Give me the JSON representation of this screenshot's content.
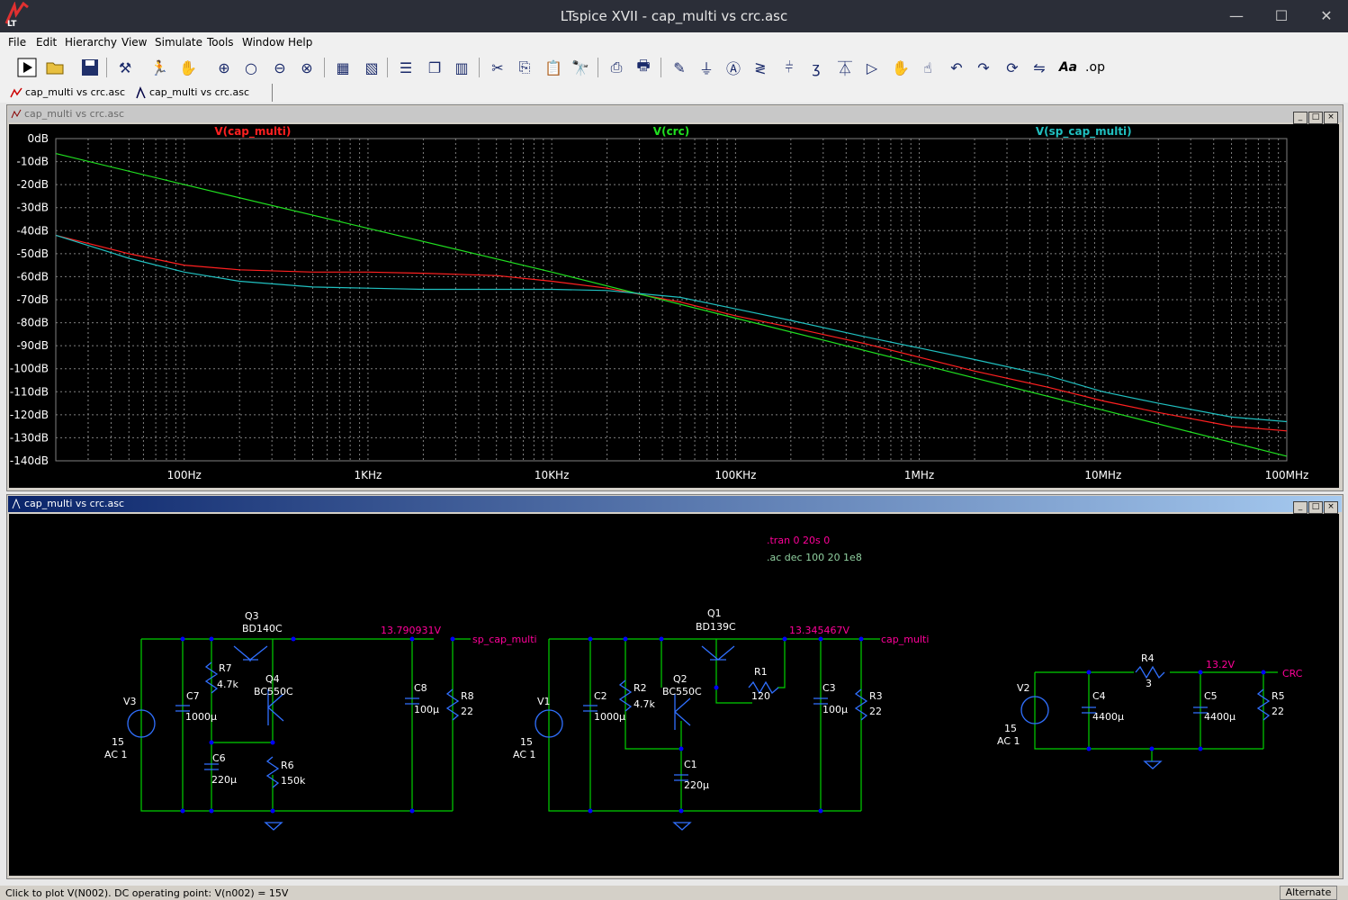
{
  "app": {
    "title": "LTspice XVII - cap_multi vs crc.asc",
    "window_buttons": {
      "minimize": "—",
      "maximize": "☐",
      "close": "✕"
    }
  },
  "menu": [
    "File",
    "Edit",
    "Hierarchy",
    "View",
    "Simulate",
    "Tools",
    "Window",
    "Help"
  ],
  "toolbar": {
    "icons": [
      "run-icon",
      "open-icon",
      "save-icon",
      "control-panel-icon",
      "halt-icon",
      "pan-icon",
      "zoom-in-icon",
      "zoom-full-icon",
      "zoom-out-icon",
      "zoom-cancel-icon",
      "autorange-icon",
      "fit-icon",
      "tile-horizontal-icon",
      "cascade-icon",
      "tile-vertical-icon",
      "cut-icon",
      "copy-icon",
      "paste-icon",
      "find-icon",
      "print-setup-icon",
      "print-icon",
      "wire-icon",
      "ground-icon",
      "label-net-icon",
      "resistor-icon",
      "capacitor-icon",
      "inductor-icon",
      "diode-icon",
      "component-icon",
      "move-icon",
      "drag-icon",
      "undo-icon",
      "redo-icon",
      "rotate-icon",
      "mirror-icon",
      "text-icon",
      "spice-directive-icon"
    ],
    "text_glyphs": {
      "text": "Aa",
      "spice": ".op"
    }
  },
  "tabs": [
    {
      "label": "cap_multi vs crc.asc",
      "icon": "waveform-icon"
    },
    {
      "label": "cap_multi vs crc.asc",
      "icon": "schematic-icon"
    }
  ],
  "plot_window": {
    "title": "cap_multi vs crc.asc",
    "colors": {
      "background": "#000000",
      "grid": "#808080",
      "axis_text": "#ffffff"
    }
  },
  "schematic_window": {
    "title": "cap_multi vs crc.asc",
    "directives": [
      ".tran 0 20s 0",
      ".ac dec 100 20 1e8"
    ],
    "components": [
      {
        "ref": "Q3",
        "value": "BD140C"
      },
      {
        "ref": "Q4",
        "value": "BC550C"
      },
      {
        "ref": "R7",
        "value": "4.7k"
      },
      {
        "ref": "C7",
        "value": "1000µ"
      },
      {
        "ref": "C6",
        "value": "220µ"
      },
      {
        "ref": "R6",
        "value": "150k"
      },
      {
        "ref": "C8",
        "value": "100µ"
      },
      {
        "ref": "R8",
        "value": "22"
      },
      {
        "ref": "V3",
        "value": "15",
        "ac": "AC 1"
      },
      {
        "ref": "Q1",
        "value": "BD139C"
      },
      {
        "ref": "Q2",
        "value": "BC550C"
      },
      {
        "ref": "R2",
        "value": "4.7k"
      },
      {
        "ref": "C2",
        "value": "1000µ"
      },
      {
        "ref": "C1",
        "value": "220µ"
      },
      {
        "ref": "R1",
        "value": "120"
      },
      {
        "ref": "C3",
        "value": "100µ"
      },
      {
        "ref": "R3",
        "value": "22"
      },
      {
        "ref": "V1",
        "value": "15",
        "ac": "AC 1"
      },
      {
        "ref": "V2",
        "value": "15",
        "ac": "AC 1"
      },
      {
        "ref": "C4",
        "value": "4400µ"
      },
      {
        "ref": "R4",
        "value": "3"
      },
      {
        "ref": "C5",
        "value": "4400µ"
      },
      {
        "ref": "R5",
        "value": "22"
      }
    ],
    "op_labels": [
      "13.790931V",
      "13.345467V",
      "13.2V"
    ],
    "net_labels": [
      "sp_cap_multi",
      "cap_multi",
      "CRC"
    ],
    "colors": {
      "background": "#000000",
      "wire": "#00ff00",
      "component": "#00a0ff",
      "text": "#ffffff",
      "label": "#ff0099"
    }
  },
  "chart_data": {
    "type": "line",
    "xlabel": "",
    "ylabel": "",
    "x_scale": "log",
    "xlim": [
      20,
      100000000
    ],
    "ylim": [
      -140,
      0
    ],
    "y_ticks": [
      "0dB",
      "-10dB",
      "-20dB",
      "-30dB",
      "-40dB",
      "-50dB",
      "-60dB",
      "-70dB",
      "-80dB",
      "-90dB",
      "-100dB",
      "-110dB",
      "-120dB",
      "-130dB",
      "-140dB"
    ],
    "x_ticks": [
      {
        "value": 100,
        "label": "100Hz"
      },
      {
        "value": 1000,
        "label": "1KHz"
      },
      {
        "value": 10000,
        "label": "10KHz"
      },
      {
        "value": 100000,
        "label": "100KHz"
      },
      {
        "value": 1000000,
        "label": "1MHz"
      },
      {
        "value": 10000000,
        "label": "10MHz"
      },
      {
        "value": 100000000,
        "label": "100MHz"
      }
    ],
    "grid": true,
    "series": [
      {
        "name": "V(cap_multi)",
        "color": "#ff2020",
        "x": [
          20,
          50,
          100,
          200,
          500,
          1000,
          2000,
          5000,
          10000,
          20000,
          50000,
          100000,
          200000,
          500000,
          1000000,
          2000000,
          5000000,
          10000000,
          20000000,
          50000000,
          100000000
        ],
        "y": [
          -42,
          -50,
          -55,
          -57,
          -58,
          -58,
          -58.5,
          -59.5,
          -62,
          -65,
          -71,
          -77,
          -82,
          -89,
          -95,
          -101,
          -108,
          -114,
          -119,
          -125,
          -127
        ]
      },
      {
        "name": "V(crc)",
        "color": "#20e020",
        "x": [
          20,
          100,
          1000,
          10000,
          100000,
          1000000,
          10000000,
          100000000
        ],
        "y": [
          -6.5,
          -20,
          -39,
          -58,
          -78,
          -98,
          -118,
          -138
        ]
      },
      {
        "name": "V(sp_cap_multi)",
        "color": "#20c0c0",
        "x": [
          20,
          50,
          100,
          200,
          500,
          1000,
          2000,
          5000,
          10000,
          20000,
          50000,
          100000,
          200000,
          500000,
          1000000,
          2000000,
          5000000,
          10000000,
          20000000,
          50000000,
          100000000
        ],
        "y": [
          -42,
          -52,
          -58,
          -62,
          -64.5,
          -65,
          -65.5,
          -65.5,
          -65.5,
          -66,
          -69,
          -74,
          -79,
          -86,
          -91,
          -96,
          -103,
          -110,
          -115,
          -121,
          -123
        ]
      }
    ]
  },
  "status": {
    "message": "Click to plot V(N002).  DC operating point: V(n002) = 15V",
    "mode": "Alternate"
  }
}
